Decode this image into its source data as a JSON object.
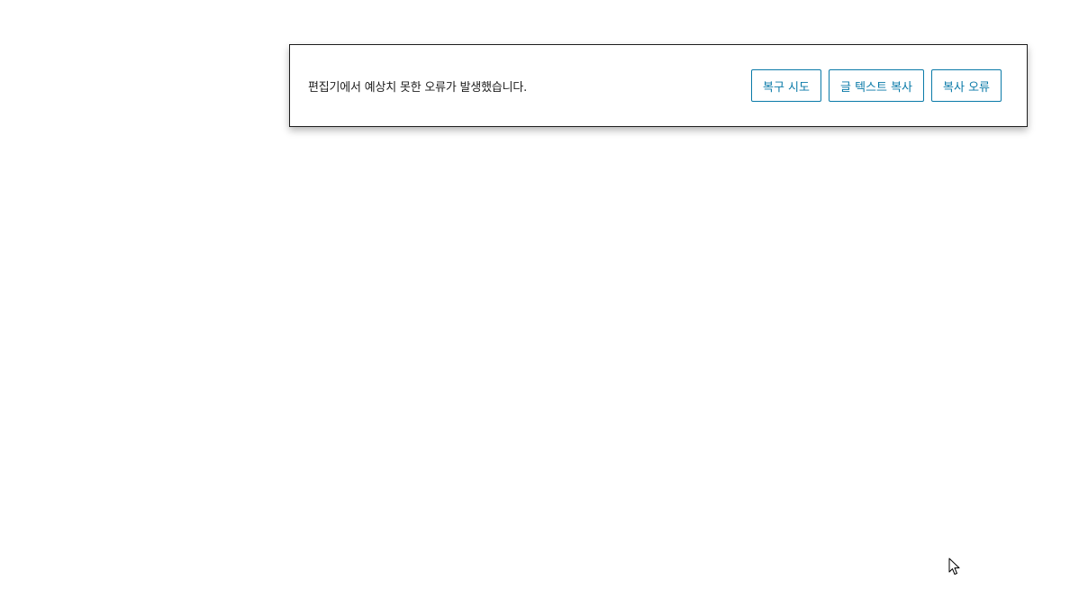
{
  "editor_error": {
    "message": "편집기에서 예상치 못한 오류가 발생했습니다.",
    "actions": [
      {
        "label": "복구 시도"
      },
      {
        "label": "글 텍스트 복사"
      },
      {
        "label": "복사 오류"
      }
    ]
  },
  "colors": {
    "accent": "#0a7aa8",
    "text": "#1e1e1e",
    "border": "#1e1e1e",
    "background": "#ffffff"
  },
  "icons": {
    "cursor": "mouse-pointer-icon"
  }
}
